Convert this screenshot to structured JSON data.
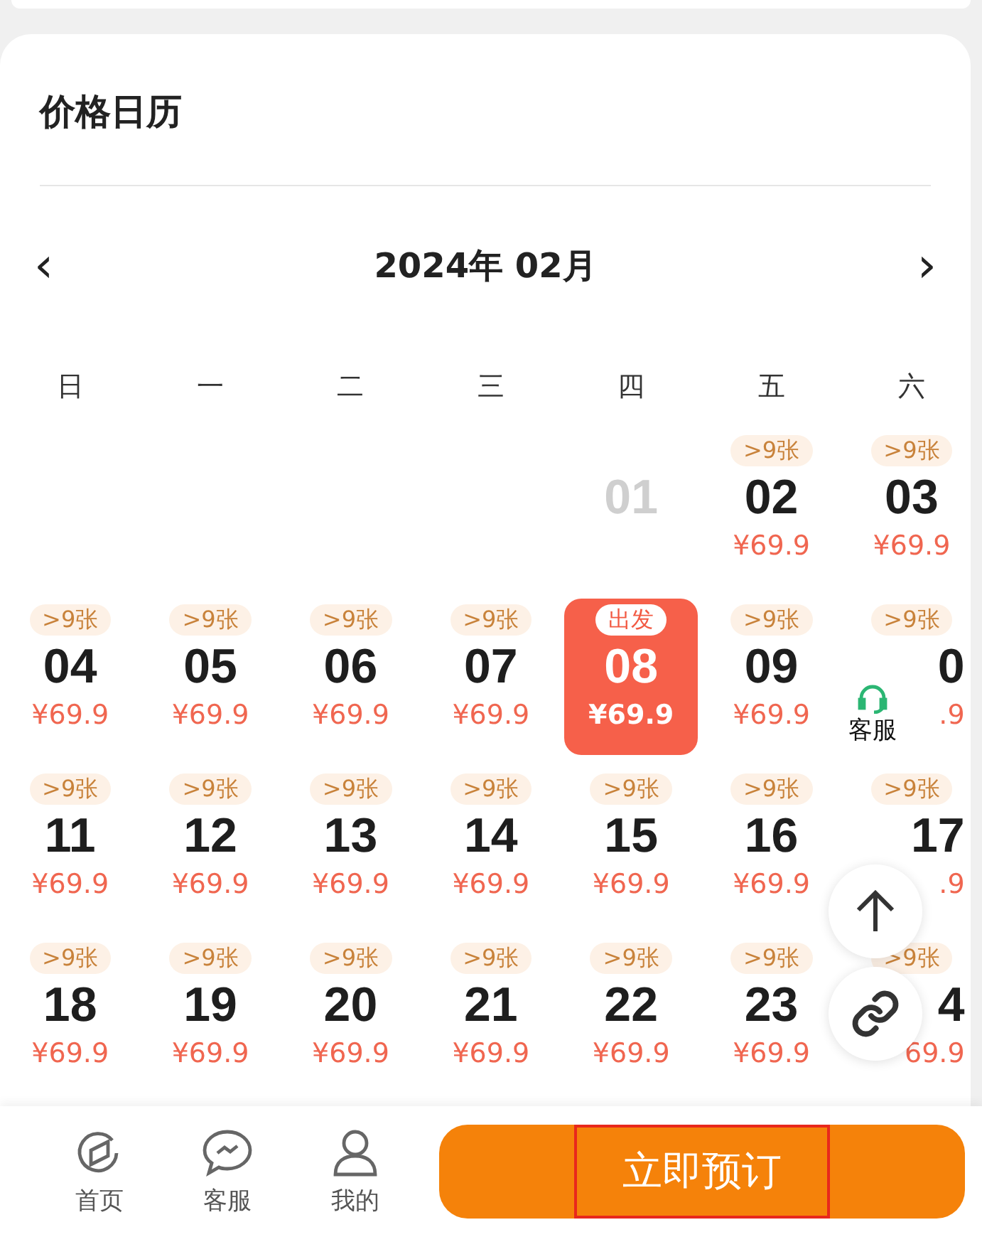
{
  "title": "价格日历",
  "month_nav": {
    "prev": "‹",
    "label": "2024年 02月",
    "next": "›"
  },
  "weekdays": [
    "日",
    "一",
    "二",
    "三",
    "四",
    "五",
    "六"
  ],
  "days": [
    {
      "kind": "blank"
    },
    {
      "kind": "blank"
    },
    {
      "kind": "blank"
    },
    {
      "kind": "blank"
    },
    {
      "kind": "day",
      "date": "01",
      "available": false,
      "selected": false
    },
    {
      "kind": "day",
      "date": "02",
      "tag": ">9张",
      "price": "¥69.9",
      "available": true,
      "selected": false
    },
    {
      "kind": "day",
      "date": "03",
      "tag": ">9张",
      "price": "¥69.9",
      "available": true,
      "selected": false
    },
    {
      "kind": "day",
      "date": "04",
      "tag": ">9张",
      "price": "¥69.9",
      "available": true,
      "selected": false
    },
    {
      "kind": "day",
      "date": "05",
      "tag": ">9张",
      "price": "¥69.9",
      "available": true,
      "selected": false
    },
    {
      "kind": "day",
      "date": "06",
      "tag": ">9张",
      "price": "¥69.9",
      "available": true,
      "selected": false
    },
    {
      "kind": "day",
      "date": "07",
      "tag": ">9张",
      "price": "¥69.9",
      "available": true,
      "selected": false
    },
    {
      "kind": "day",
      "date": "08",
      "tag": "出发",
      "price": "¥69.9",
      "available": true,
      "selected": true
    },
    {
      "kind": "day",
      "date": "09",
      "tag": ">9张",
      "price": "¥69.9",
      "available": true,
      "selected": false
    },
    {
      "kind": "day",
      "date": "0",
      "tag": ">9张",
      "price": ".9",
      "available": true,
      "selected": false,
      "covered": true
    },
    {
      "kind": "day",
      "date": "11",
      "tag": ">9张",
      "price": "¥69.9",
      "available": true,
      "selected": false
    },
    {
      "kind": "day",
      "date": "12",
      "tag": ">9张",
      "price": "¥69.9",
      "available": true,
      "selected": false
    },
    {
      "kind": "day",
      "date": "13",
      "tag": ">9张",
      "price": "¥69.9",
      "available": true,
      "selected": false
    },
    {
      "kind": "day",
      "date": "14",
      "tag": ">9张",
      "price": "¥69.9",
      "available": true,
      "selected": false
    },
    {
      "kind": "day",
      "date": "15",
      "tag": ">9张",
      "price": "¥69.9",
      "available": true,
      "selected": false
    },
    {
      "kind": "day",
      "date": "16",
      "tag": ">9张",
      "price": "¥69.9",
      "available": true,
      "selected": false
    },
    {
      "kind": "day",
      "date": "17",
      "tag": ">9张",
      "price": ".9",
      "available": true,
      "selected": false,
      "covered": true
    },
    {
      "kind": "day",
      "date": "18",
      "tag": ">9张",
      "price": "¥69.9",
      "available": true,
      "selected": false
    },
    {
      "kind": "day",
      "date": "19",
      "tag": ">9张",
      "price": "¥69.9",
      "available": true,
      "selected": false
    },
    {
      "kind": "day",
      "date": "20",
      "tag": ">9张",
      "price": "¥69.9",
      "available": true,
      "selected": false
    },
    {
      "kind": "day",
      "date": "21",
      "tag": ">9张",
      "price": "¥69.9",
      "available": true,
      "selected": false
    },
    {
      "kind": "day",
      "date": "22",
      "tag": ">9张",
      "price": "¥69.9",
      "available": true,
      "selected": false
    },
    {
      "kind": "day",
      "date": "23",
      "tag": ">9张",
      "price": "¥69.9",
      "available": true,
      "selected": false
    },
    {
      "kind": "day",
      "date": "4",
      "tag": ">9张",
      "price": "69.9",
      "available": true,
      "selected": false,
      "covered": true
    }
  ],
  "floating": {
    "service_label": "客服"
  },
  "bottom_nav": [
    {
      "kind": "home",
      "label": "首页"
    },
    {
      "kind": "chat",
      "label": "客服"
    },
    {
      "kind": "user",
      "label": "我的"
    }
  ],
  "book_button": {
    "label": "立即预订",
    "highlighted": true
  }
}
